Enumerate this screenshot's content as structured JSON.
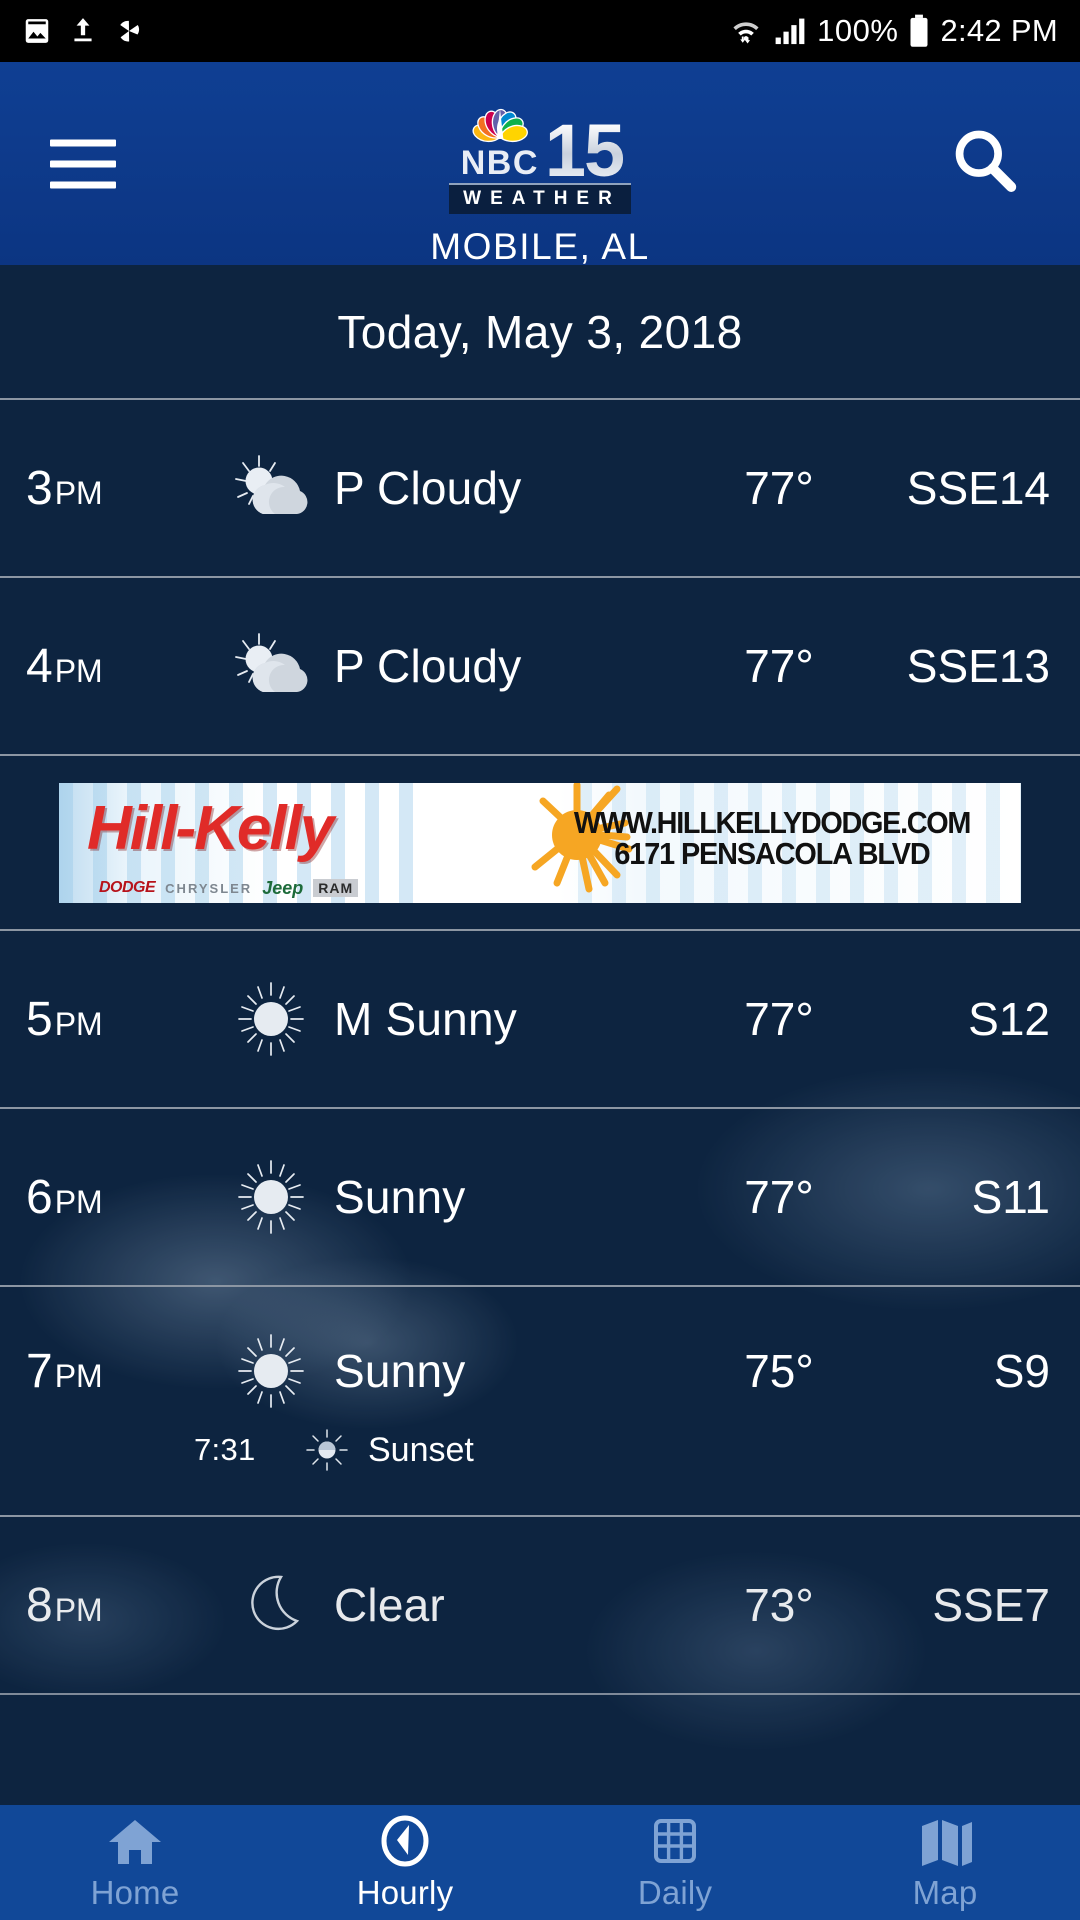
{
  "status_bar": {
    "icons": [
      "image-icon",
      "upload-icon",
      "pinwheel-icon",
      "wifi-icon",
      "cellular-signal-icon",
      "battery-icon"
    ],
    "battery_percent": "100%",
    "clock": "2:42 PM"
  },
  "header": {
    "menu_icon": "hamburger-menu-icon",
    "search_icon": "search-icon",
    "logo": {
      "peacock_icon": "nbc-peacock-icon",
      "network": "NBC",
      "channel": "15",
      "tagline": "WEATHER"
    },
    "city": "MOBILE, AL",
    "background_color": "#0d3b8c"
  },
  "date_header": "Today, May 3, 2018",
  "forecast": {
    "rows": [
      {
        "time": "3",
        "meridiem": "PM",
        "icon": "partly-cloudy-icon",
        "condition": "P Cloudy",
        "temp": "77°",
        "wind": "SSE14"
      },
      {
        "time": "4",
        "meridiem": "PM",
        "icon": "partly-cloudy-icon",
        "condition": "P Cloudy",
        "temp": "77°",
        "wind": "SSE13"
      },
      {
        "time": "5",
        "meridiem": "PM",
        "icon": "sunny-icon",
        "condition": "M Sunny",
        "temp": "77°",
        "wind": "S12"
      },
      {
        "time": "6",
        "meridiem": "PM",
        "icon": "sunny-icon",
        "condition": "Sunny",
        "temp": "77°",
        "wind": "S11"
      },
      {
        "time": "7",
        "meridiem": "PM",
        "icon": "sunny-icon",
        "condition": "Sunny",
        "temp": "75°",
        "wind": "S9"
      }
    ],
    "sunset": {
      "time": "7:31",
      "icon": "sunset-icon",
      "label": "Sunset"
    }
  },
  "ad": {
    "brand": "Hill-Kelly",
    "sun_icon": "sun-burst-icon",
    "sub_brands": [
      "DODGE",
      "CHRYSLER",
      "Jeep",
      "RAM"
    ],
    "url": "WWW.HILLKELLYDODGE.COM",
    "address": "6171 PENSACOLA BLVD"
  },
  "bottom_nav": {
    "active": "Hourly",
    "tabs": [
      {
        "label": "Home",
        "icon": "home-icon"
      },
      {
        "label": "Hourly",
        "icon": "clock-icon"
      },
      {
        "label": "Daily",
        "icon": "calendar-icon"
      },
      {
        "label": "Map",
        "icon": "map-icon"
      }
    ]
  }
}
